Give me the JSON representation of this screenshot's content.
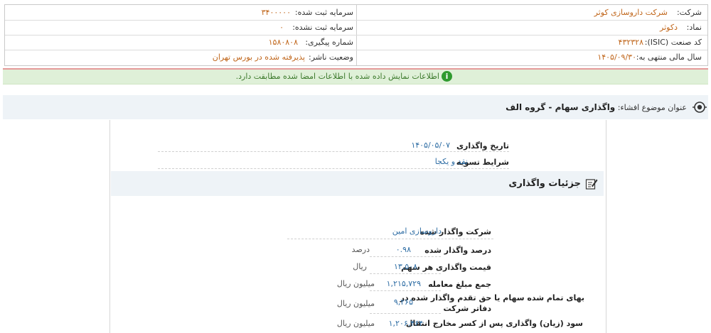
{
  "info": {
    "company_label": "شرکت:",
    "company_value": "شرکت داروسازی کوثر",
    "registered_capital_label": "سرمایه ثبت شده:",
    "registered_capital_value": "۳۴۰۰۰۰۰",
    "symbol_label": "نماد:",
    "symbol_value": "دکوثر",
    "unregistered_capital_label": "سرمایه ثبت نشده:",
    "unregistered_capital_value": "۰",
    "isic_label": "کد صنعت (ISIC):",
    "isic_value": "۴۳۲۳۲۸",
    "tracking_label": "شماره پیگیری:",
    "tracking_value": "۱۵۸۰۸۰۸",
    "fiscal_label": "سال مالی منتهی به:",
    "fiscal_value": "۱۴۰۵/۰۹/۳۰",
    "status_label": "وضعیت ناشر:",
    "status_value": "پذیرفته شده در بورس تهران"
  },
  "banner": {
    "message": "اطلاعات نمایش داده شده با اطلاعات امضا شده مطابقت دارد.",
    "icon": "info-icon",
    "color": "#dff0d8"
  },
  "subject": {
    "label": "عنوان موضوع افشاء:",
    "title": "واگذاری سهام - گروه الف"
  },
  "transfer": {
    "date_label": "تاریخ واگذاری",
    "date_value": "۱۴۰۵/۰۵/۰۷",
    "settlement_label": "شرایط تسویه",
    "settlement_value": "نقد و یکجا"
  },
  "details": {
    "title": "جزئیات واگذاری",
    "icon": "edit-icon",
    "company_label": "شرکت واگذار شده",
    "company_value": "داروسازی امین",
    "percent_label": "درصد واگذار شده",
    "percent_value": "۰.۹۸",
    "percent_unit": "درصد",
    "price_label": "قیمت واگذاری هر سهم",
    "price_value": "۱۳,۵۰۸",
    "price_unit": "ریال",
    "total_label": "جمع مبلغ معامله",
    "total_value": "۱,۲۱۵,۷۲۹",
    "total_unit": "میلیون ریال",
    "cost_label_1": "بهای تمام شده سهام یا حق تقدم واگذار شده در",
    "cost_label_2": "دفاتر شرکت",
    "cost_value": "۹,۲۶۵",
    "cost_unit": "میلیون ریال",
    "partial_label": "سود (زیان) واگذاری پس از کسر مخارج انتقال",
    "partial_value": "۱,۲۰۶,۴۶۴",
    "partial_unit": "میلیون ریال"
  }
}
